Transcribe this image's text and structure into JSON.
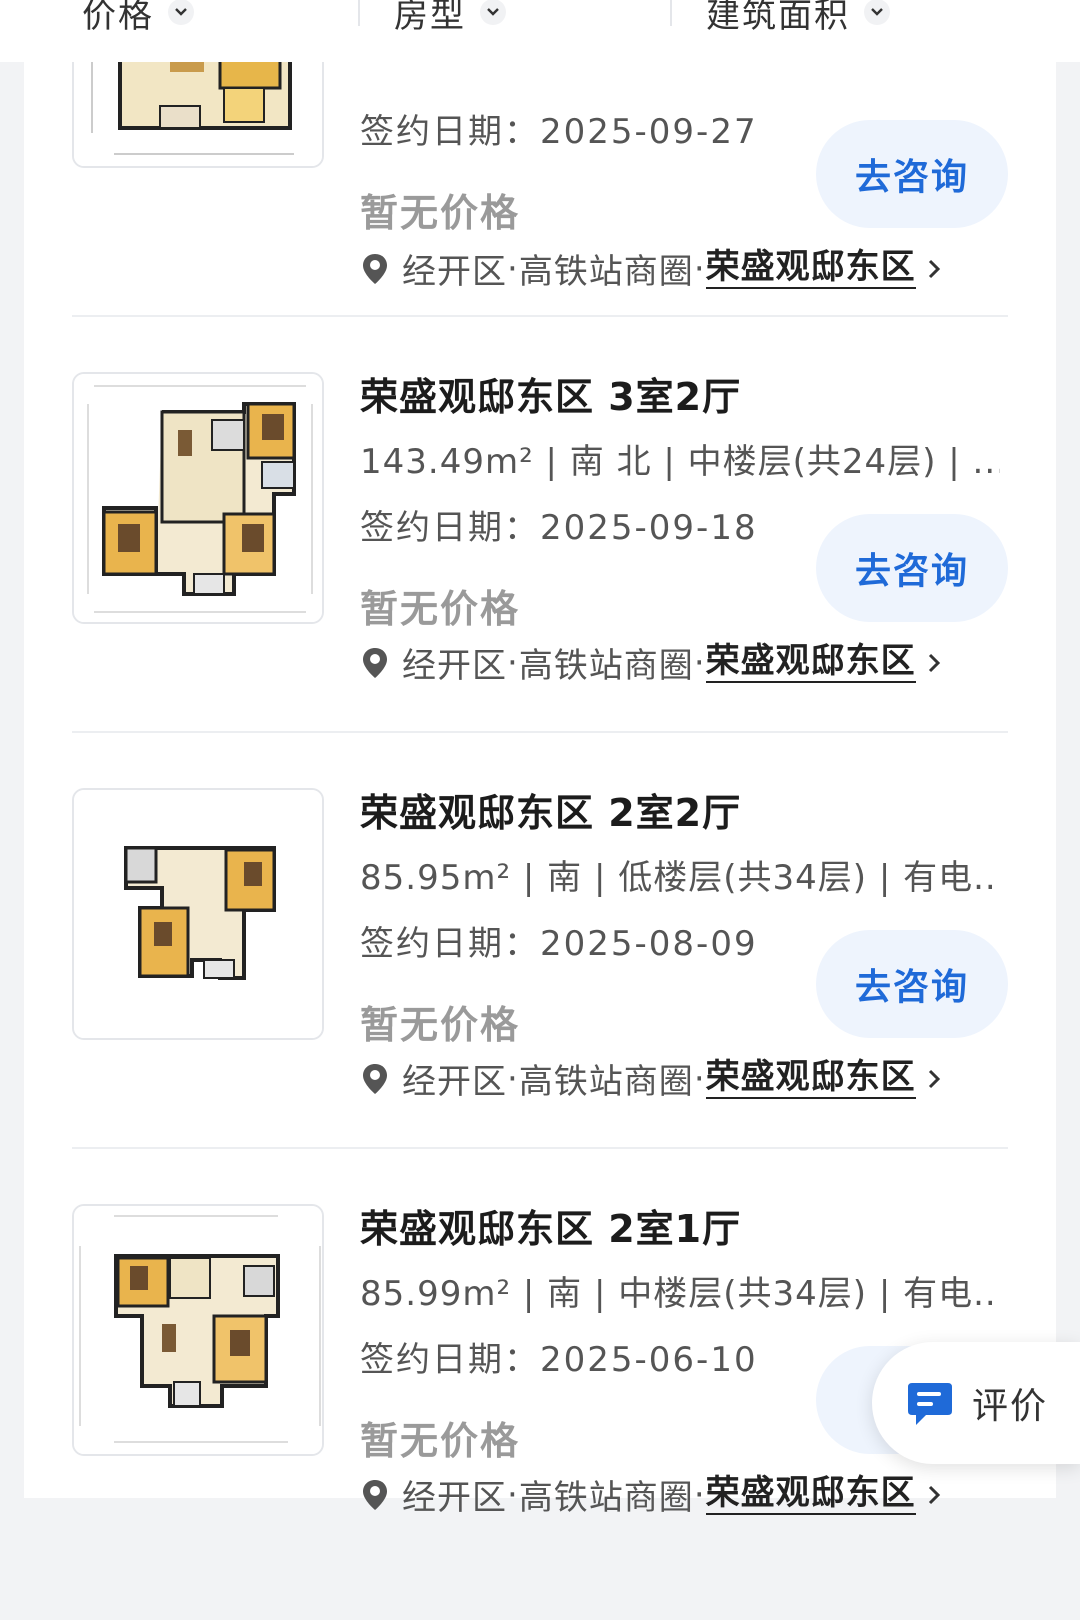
{
  "filters": [
    {
      "label": "价格"
    },
    {
      "label": "房型"
    },
    {
      "label": "建筑面积"
    }
  ],
  "listings": [
    {
      "title": "",
      "meta": "",
      "sign_date": "签约日期：2025-09-27",
      "price": "暂无价格",
      "consult_label": "去咨询",
      "district": "经开区",
      "business_area": "高铁站商圈",
      "community": "荣盛观邸东区"
    },
    {
      "title": "荣盛观邸东区 3室2厅",
      "area": "143.49m²",
      "meta": "143.49m² | 南 北 | 中楼层(共24层) | ...",
      "sign_date": "签约日期：2025-09-18",
      "price": "暂无价格",
      "consult_label": "去咨询",
      "district": "经开区",
      "business_area": "高铁站商圈",
      "community": "荣盛观邸东区"
    },
    {
      "title": "荣盛观邸东区 2室2厅",
      "meta": "85.95m² | 南 | 低楼层(共34层) | 有电...",
      "sign_date": "签约日期：2025-08-09",
      "price": "暂无价格",
      "consult_label": "去咨询",
      "district": "经开区",
      "business_area": "高铁站商圈",
      "community": "荣盛观邸东区"
    },
    {
      "title": "荣盛观邸东区 2室1厅",
      "meta": "85.99m² | 南 | 中楼层(共34层) | 有电...",
      "sign_date": "签约日期：2025-06-10",
      "price": "暂无价格",
      "consult_label": "去",
      "district": "经开区",
      "business_area": "高铁站商圈",
      "community": "荣盛观邸东区"
    }
  ],
  "float_button": {
    "label": "评价",
    "icon": "chat-icon"
  },
  "colors": {
    "accent": "#1f6ad8",
    "accent_bg": "#eef4fd",
    "price_gray": "#9a9a9a"
  }
}
